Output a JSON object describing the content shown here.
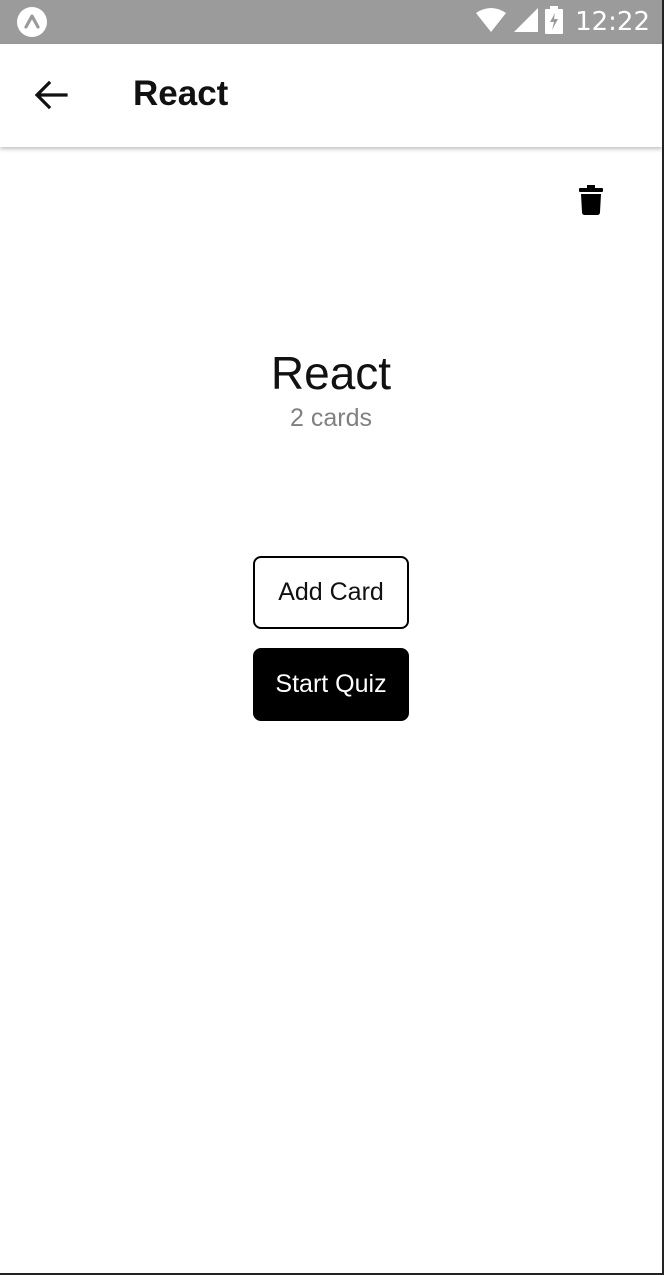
{
  "status_bar": {
    "time": "12:22",
    "icons": [
      "expo-icon",
      "wifi-icon",
      "signal-icon",
      "battery-charging-icon"
    ],
    "background_color": "#9b9b9b"
  },
  "header": {
    "title": "React",
    "back_icon": "arrow-left-icon"
  },
  "deck": {
    "title": "React",
    "card_count": "2 cards",
    "delete_icon": "trash-icon"
  },
  "actions": {
    "add_card_label": "Add Card",
    "start_quiz_label": "Start Quiz"
  }
}
